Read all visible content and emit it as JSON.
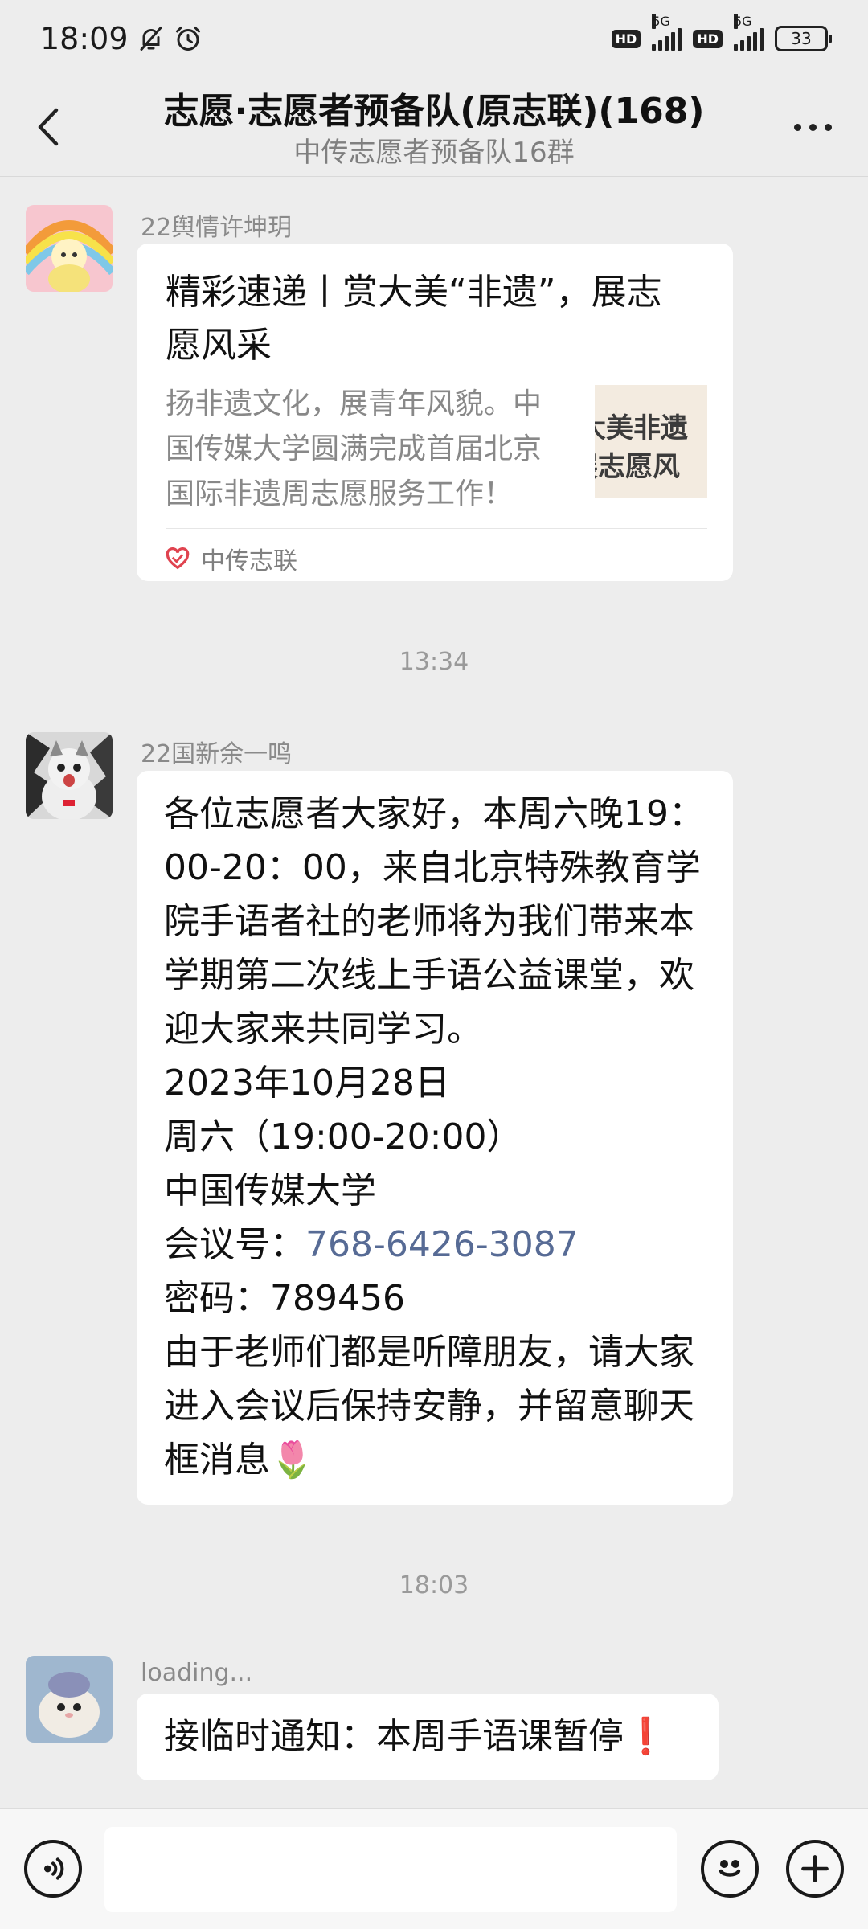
{
  "status_bar": {
    "time": "18:09",
    "network_1": "5G",
    "network_2": "5G",
    "hd": "HD",
    "battery": "33"
  },
  "header": {
    "title": "志愿·志愿者预备队(原志联)(168)",
    "subtitle": "中传志愿者预备队16群"
  },
  "messages": [
    {
      "sender": "22舆情许坤玥",
      "type": "card",
      "card_title_lines": [
        "精彩速递丨赏大美“非遗”，展志",
        "愿风采"
      ],
      "card_desc_lines": [
        "扬非遗文化，展青年风貌。中",
        "国传媒大学圆满完成首届北京",
        "国际非遗周志愿服务工作！"
      ],
      "thumb_lines": [
        "大美非遗",
        "展志愿风"
      ],
      "source": "中传志联"
    },
    {
      "timestamp": "13:34"
    },
    {
      "sender": "22国新余一鸣",
      "type": "text",
      "lines": [
        "各位志愿者大家好，本周六晚19：",
        "00-20：00，来自北京特殊教育学",
        "院手语者社的老师将为我们带来本",
        "学期第二次线上手语公益课堂，欢",
        "迎大家来共同学习。",
        "2023年10月28日",
        "周六（19:00-20:00）",
        "中国传媒大学"
      ],
      "meeting_label": "会议号：",
      "meeting_number": "768-6426-3087",
      "password_line": "密码：789456",
      "tail_lines": [
        "由于老师们都是听障朋友，请大家",
        "进入会议后保持安静，并留意聊天",
        "框消息🌷"
      ]
    },
    {
      "timestamp": "18:03"
    },
    {
      "sender": "loading...",
      "type": "text",
      "text": "接临时通知：本周手语课暂停❗"
    }
  ],
  "input_bar": {
    "placeholder": ""
  },
  "icons": {
    "back": "back-arrow-icon",
    "more": "more-dots-icon",
    "voice": "voice-icon",
    "emoji": "emoji-icon",
    "plus": "plus-icon",
    "mute": "bell-off-icon",
    "alarm": "alarm-icon"
  },
  "colors": {
    "background": "#ededed",
    "bubble": "#ffffff",
    "link": "#576b95",
    "source_heart": "#e0434f"
  }
}
